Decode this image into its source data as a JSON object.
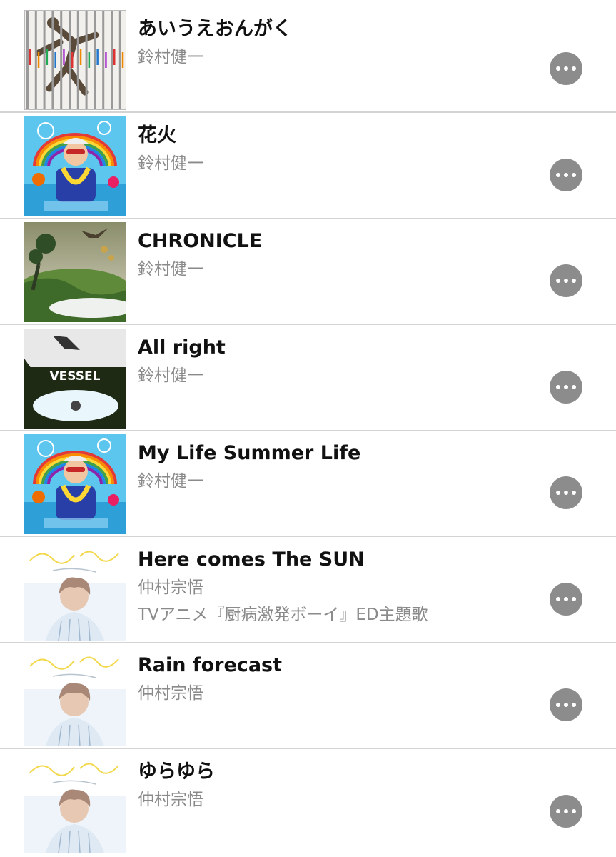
{
  "songs": [
    {
      "title": "あいうえおんがく",
      "artist": "鈴村健一",
      "note": "",
      "artwork": "bars"
    },
    {
      "title": "花火",
      "artist": "鈴村健一",
      "note": "",
      "artwork": "summer"
    },
    {
      "title": "CHRONICLE",
      "artist": "鈴村健一",
      "note": "",
      "artwork": "landscape"
    },
    {
      "title": "All right",
      "artist": "鈴村健一",
      "note": "",
      "artwork": "vessel",
      "artwork_text": "VESSEL"
    },
    {
      "title": "My Life Summer Life",
      "artist": "鈴村健一",
      "note": "",
      "artwork": "summer"
    },
    {
      "title": "Here comes The SUN",
      "artist": "仲村宗悟",
      "note": "TVアニメ『厨病激発ボーイ』ED主題歌",
      "artwork": "sun"
    },
    {
      "title": "Rain forecast",
      "artist": "仲村宗悟",
      "note": "",
      "artwork": "sun"
    },
    {
      "title": "ゆらゆら",
      "artist": "仲村宗悟",
      "note": "",
      "artwork": "sun"
    }
  ],
  "more_icon": "more-horizontal-icon",
  "colors": {
    "title": "#111111",
    "subtitle": "#8a8a8a",
    "divider": "#d4d4d4",
    "more_button": "#8c8c8c"
  }
}
